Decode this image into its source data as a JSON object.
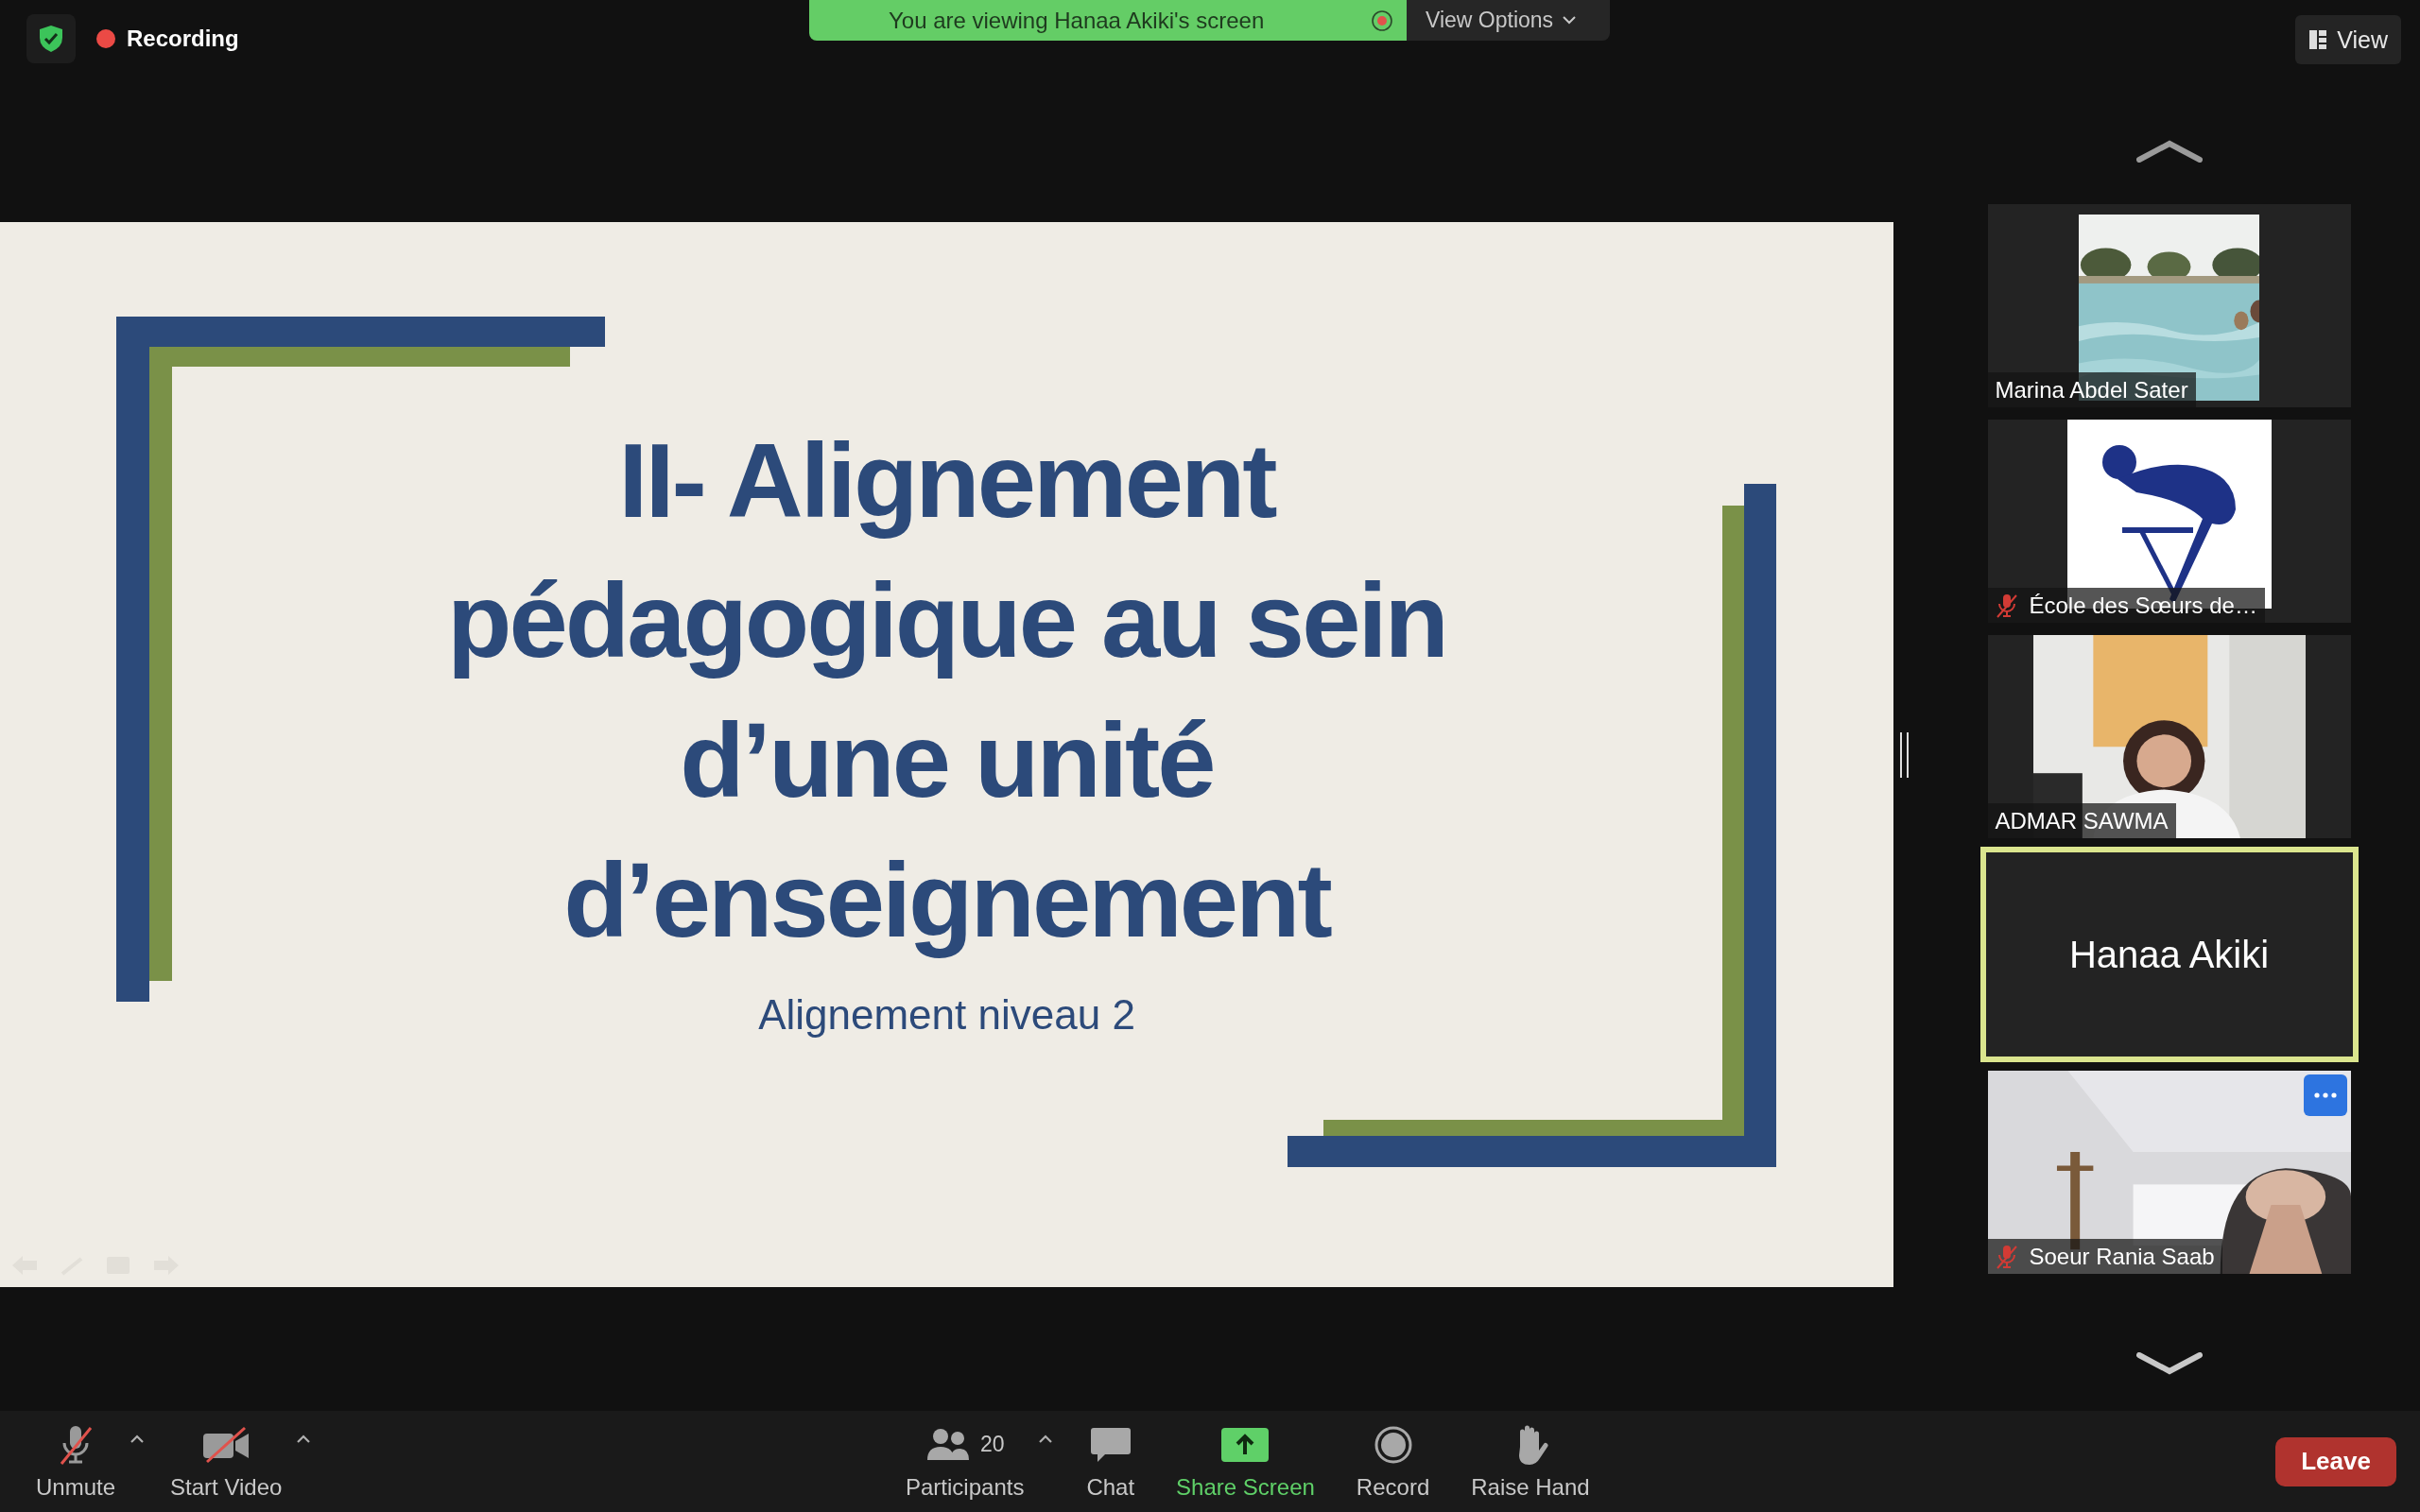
{
  "top_bar": {
    "recording": {
      "label": "Recording",
      "on": true
    },
    "banner": {
      "text": "You are viewing Hanaa Akiki's screen"
    },
    "view_options": {
      "label": "View Options"
    },
    "view_button": {
      "label": "View"
    }
  },
  "slide": {
    "title_lines": [
      "II- Alignement",
      "pédagogique au sein",
      "d’une unité",
      "d’enseignement"
    ],
    "subtitle": "Alignement niveau 2"
  },
  "participants": [
    {
      "kind": "picture",
      "name": "Marina Abdel Sater",
      "muted": false,
      "speaking": false,
      "menu_shown": false
    },
    {
      "kind": "avatar",
      "name": "École des Sœurs de…",
      "muted": true,
      "speaking": false,
      "menu_shown": false
    },
    {
      "kind": "picture",
      "name": "ADMAR SAWMA",
      "muted": false,
      "speaking": false,
      "menu_shown": false
    },
    {
      "kind": "name",
      "name": "Hanaa Akiki",
      "muted": false,
      "speaking": true,
      "menu_shown": false
    },
    {
      "kind": "picture",
      "name": "Soeur Rania Saab",
      "muted": true,
      "speaking": false,
      "menu_shown": true
    }
  ],
  "toolbar": {
    "items": [
      {
        "kind": "mic",
        "label": "Unmute",
        "off": true,
        "has_menu": true
      },
      {
        "kind": "video",
        "label": "Start Video",
        "off": true,
        "has_menu": true
      },
      {
        "kind": "participants",
        "label": "Participants",
        "count": "20",
        "has_menu": true
      },
      {
        "kind": "chat",
        "label": "Chat",
        "has_menu": false
      },
      {
        "kind": "share",
        "label": "Share Screen",
        "has_menu": false
      },
      {
        "kind": "record",
        "label": "Record",
        "has_menu": false
      },
      {
        "kind": "hand",
        "label": "Raise Hand",
        "has_menu": false
      }
    ],
    "leave": "Leave"
  }
}
